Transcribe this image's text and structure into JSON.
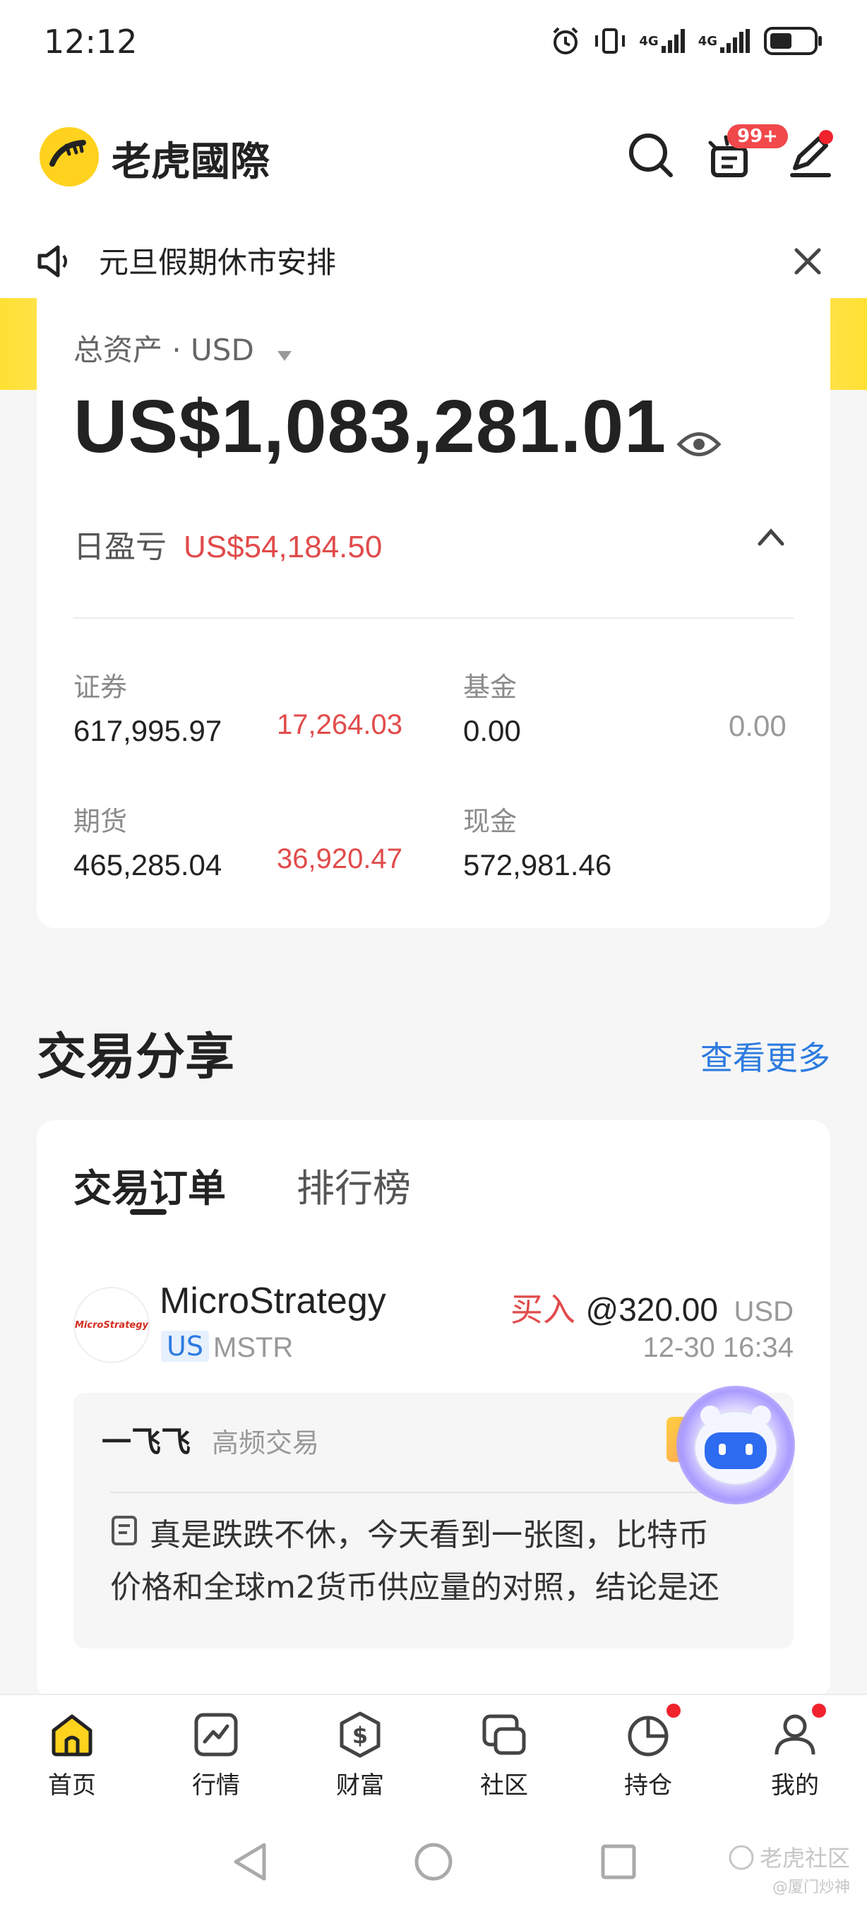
{
  "status_bar": {
    "time": "12:12",
    "signal1": "4G",
    "signal2": "4G"
  },
  "header": {
    "app_name": "老虎國際",
    "notification_badge": "99+"
  },
  "notice": {
    "text": "元旦假期休市安排"
  },
  "assets": {
    "total_label": "总资产 · USD",
    "total_value": "US$1,083,281.01",
    "daily_pnl_label": "日盈亏",
    "daily_pnl_value": "US$54,184.50",
    "items": [
      {
        "label": "证券",
        "value": "617,995.97",
        "change": "17,264.03"
      },
      {
        "label": "基金",
        "value": "0.00",
        "change": "0.00"
      },
      {
        "label": "期货",
        "value": "465,285.04",
        "change": "36,920.47"
      },
      {
        "label": "现金",
        "value": "572,981.46",
        "change": ""
      }
    ]
  },
  "trade_share": {
    "title": "交易分享",
    "see_more": "查看更多",
    "tabs": [
      "交易订单",
      "排行榜"
    ],
    "order": {
      "logo_text": "MicroStrategy",
      "name": "MicroStrategy",
      "market": "US",
      "ticker": "MSTR",
      "side": "买入",
      "price": "@320.00",
      "currency": "USD",
      "time": "12-30 16:34"
    },
    "post": {
      "author": "一飞飞",
      "author_tag": "高频交易",
      "text_line1": "真是跌跌不休，今天看到一张图，比特币",
      "text_line2": "价格和全球m2货币供应量的对照，结论是还"
    }
  },
  "tabbar": {
    "items": [
      "首页",
      "行情",
      "财富",
      "社区",
      "持仓",
      "我的"
    ]
  },
  "watermark": {
    "line1": "老虎社区",
    "line2": "@厦门炒神"
  },
  "colors": {
    "brand_yellow": "#ffd21e",
    "profit_red": "#e14b4b",
    "link_blue": "#2d7be0"
  }
}
